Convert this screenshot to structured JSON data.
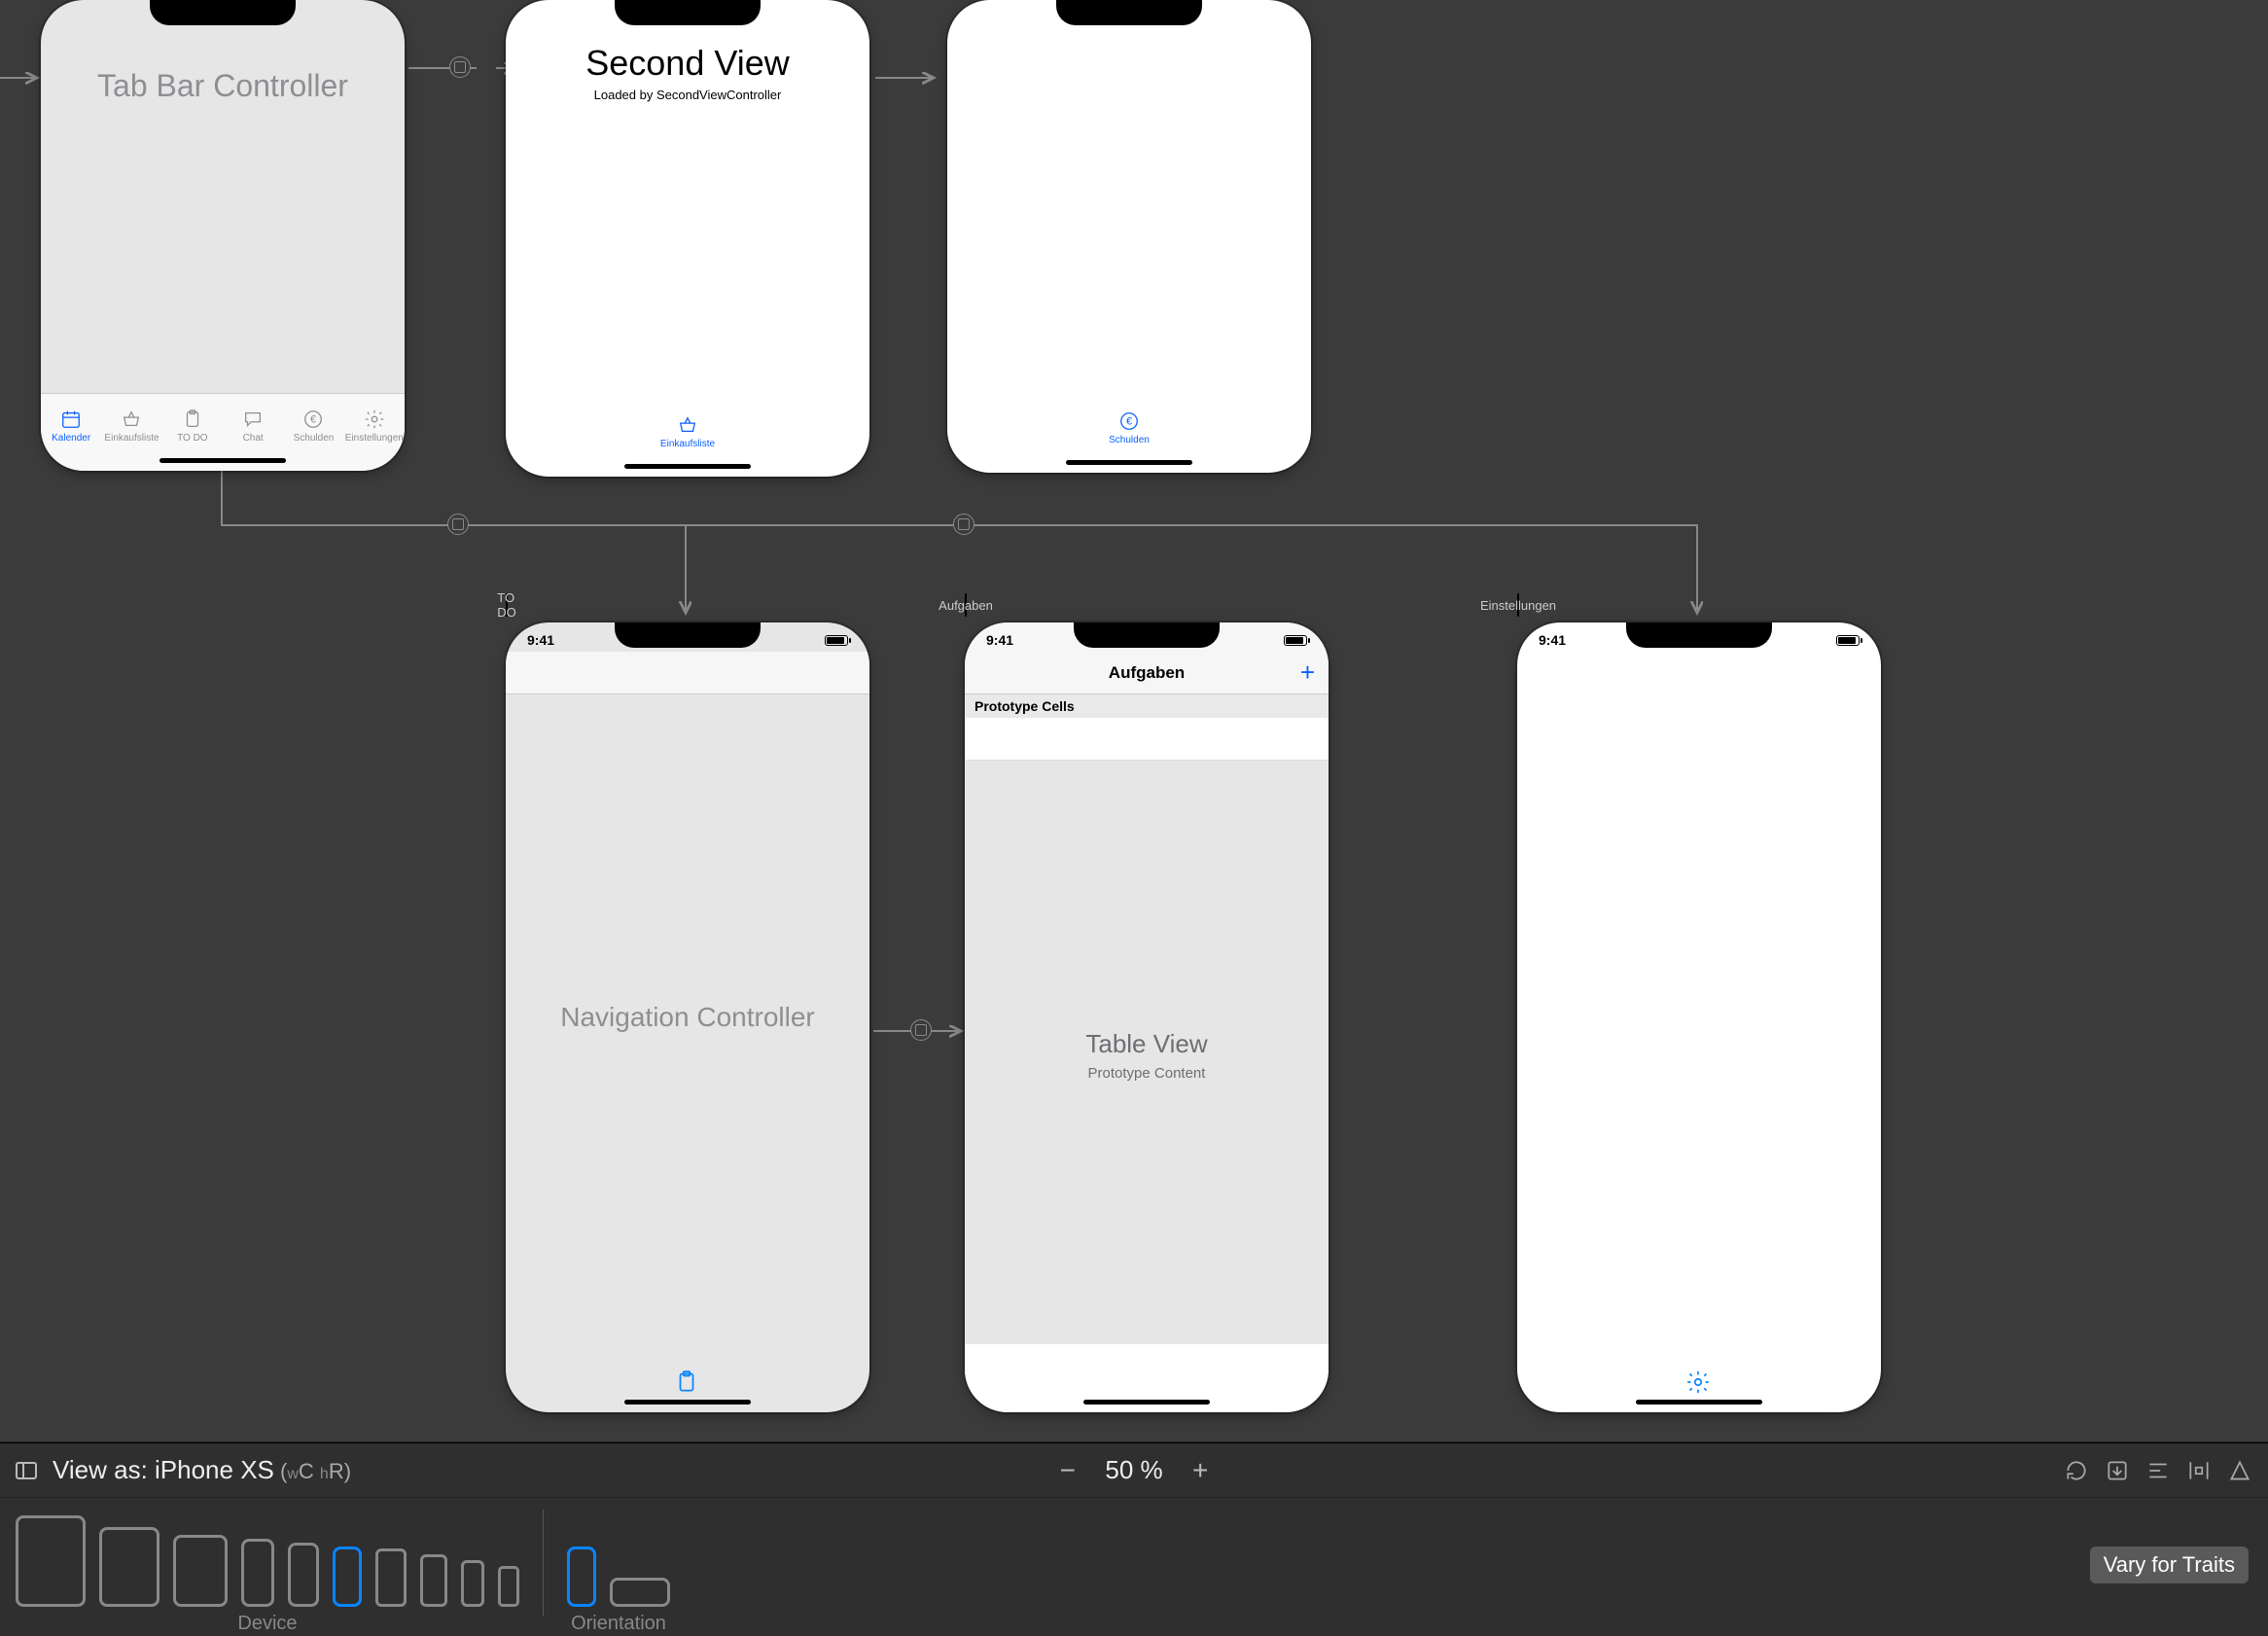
{
  "footer": {
    "view_as_prefix": "View as: ",
    "view_as_device": "iPhone XS",
    "traits_open": " (",
    "traits_w": "w",
    "traits_c": "C ",
    "traits_h": "h",
    "traits_r": "R",
    "traits_close": ")",
    "zoom": "50 %",
    "device_label": "Device",
    "orientation_label": "Orientation",
    "vary_label": "Vary for Traits"
  },
  "scenes": {
    "tabbar_controller": {
      "title": "Tab Bar Controller",
      "tabs": [
        {
          "label": "Kalender"
        },
        {
          "label": "Einkaufsliste"
        },
        {
          "label": "TO DO"
        },
        {
          "label": "Chat"
        },
        {
          "label": "Schulden"
        },
        {
          "label": "Einstellungen"
        }
      ]
    },
    "second_view": {
      "title": "Second View",
      "subtitle": "Loaded by SecondViewController",
      "tab_label": "Einkaufsliste"
    },
    "schulden_view": {
      "tab_label": "Schulden"
    },
    "todo_nav": {
      "scene_bar": "TO DO",
      "status_time": "9:41",
      "title": "Navigation Controller"
    },
    "aufgaben": {
      "scene_bar": "Aufgaben",
      "status_time": "9:41",
      "nav_title": "Aufgaben",
      "add_symbol": "+",
      "proto_header": "Prototype Cells",
      "table_title": "Table View",
      "table_sub": "Prototype Content"
    },
    "einstellungen": {
      "scene_bar": "Einstellungen",
      "status_time": "9:41"
    }
  }
}
